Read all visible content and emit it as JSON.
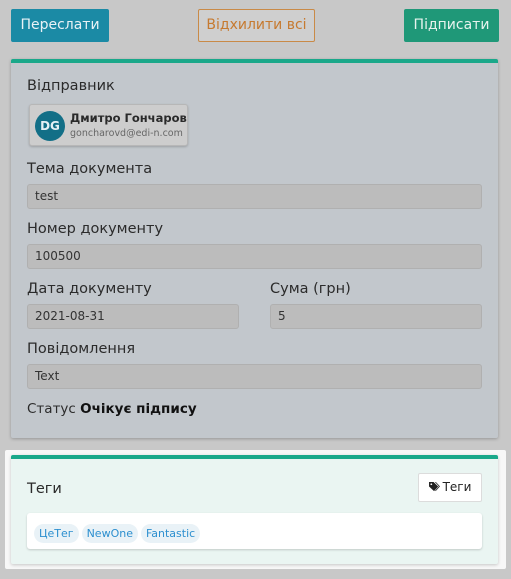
{
  "toolbar": {
    "forward_label": "Переслати",
    "reject_all_label": "Відхилити всі",
    "sign_label": "Підписати"
  },
  "document": {
    "sender_label": "Відправник",
    "sender": {
      "initials": "DG",
      "name": "Дмитро Гончаров",
      "email": "goncharovd@edi-n.com"
    },
    "subject_label": "Тема документа",
    "subject_value": "test",
    "number_label": "Номер документу",
    "number_value": "100500",
    "date_label": "Дата документу",
    "date_value": "2021-08-31",
    "amount_label": "Сума (грн)",
    "amount_value": "5",
    "message_label": "Повідомлення",
    "message_value": "Text",
    "status_label": "Статус",
    "status_value": "Очікує підпису"
  },
  "tags": {
    "title": "Теги",
    "button_label": "Теги",
    "items": [
      "ЦеТег",
      "NewOne",
      "Fantastic"
    ]
  },
  "colors": {
    "forward_button": "#1b8aa5",
    "sign_button": "#1f9878",
    "reject_border": "#c98a47",
    "card_accent": "#1aa88a",
    "tag_text": "#2c8fcf"
  },
  "icons": {
    "tags_button_icon": "tag-icon"
  }
}
